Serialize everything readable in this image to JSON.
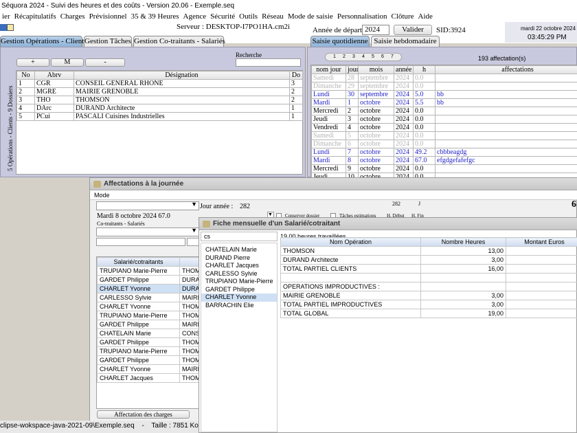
{
  "window": {
    "title": "Séquora 2024 - Suivi des heures et des coûts - Version 20.06 - Exemple.seq"
  },
  "menu": [
    "ier",
    "Récapitulatifs",
    "Charges",
    "Prévisionnel",
    "35 & 39 Heures",
    "Agence",
    "Sécurité",
    "Outils",
    "Réseau",
    "Mode de saisie",
    "Personnalisation",
    "Clôture",
    "Aide"
  ],
  "header": {
    "server_label": "Serveur : DESKTOP-I7PO1HA.cm2i",
    "year_label": "Année de départ :",
    "year_value": "2024",
    "validate_label": "Valider",
    "sid": "SID:3924",
    "date": "mardi 22 octobre 2024",
    "time": "03:45:29 PM"
  },
  "tabs_left": [
    "Gestion Opérations - Clients",
    "Gestion Tâches",
    "Gestion Co-traitants - Salariés"
  ],
  "tabs_right": [
    "Saisie quotidienne",
    "Saisie hebdomadaire"
  ],
  "operations": {
    "buttons": [
      "+",
      "M",
      "-"
    ],
    "search_label": "Recherche",
    "side_label": "5 Opérations - Clients - 9 Dossiers",
    "columns": [
      "No",
      "Abrv",
      "Désignation",
      "Do"
    ],
    "rows": [
      [
        "1",
        "CGR",
        "CONSEIL GENERAL RHONE",
        "3"
      ],
      [
        "2",
        "MGRE",
        "MAIRIE GRENOBLE",
        "2"
      ],
      [
        "3",
        "THO",
        "THOMSON",
        "2"
      ],
      [
        "4",
        "DArc",
        "DURAND Architecte",
        "1"
      ],
      [
        "5",
        "PCui",
        "PASCALI Cuisines Industrielles",
        "1"
      ]
    ]
  },
  "daily": {
    "pages": [
      "1",
      "2",
      "3",
      "4",
      "5",
      "6",
      "7"
    ],
    "count_label": "193 affectation(s)",
    "columns": [
      "nom jour",
      "jour",
      "mois",
      "année",
      "h",
      "affectations"
    ],
    "rows": [
      {
        "cells": [
          "Samedi",
          "28",
          "septembre",
          "2024",
          "0.0",
          ""
        ],
        "style": "grey"
      },
      {
        "cells": [
          "Dimanche",
          "29",
          "septembre",
          "2024",
          "0.0",
          ""
        ],
        "style": "grey"
      },
      {
        "cells": [
          "Lundi",
          "30",
          "septembre",
          "2024",
          "5.0",
          "bb"
        ],
        "style": "blue"
      },
      {
        "cells": [
          "Mardi",
          "1",
          "octobre",
          "2024",
          "5.5",
          "bb"
        ],
        "style": "blue"
      },
      {
        "cells": [
          "Mercredi",
          "2",
          "octobre",
          "2024",
          "0.0",
          ""
        ],
        "style": ""
      },
      {
        "cells": [
          "Jeudi",
          "3",
          "octobre",
          "2024",
          "0.0",
          ""
        ],
        "style": ""
      },
      {
        "cells": [
          "Vendredi",
          "4",
          "octobre",
          "2024",
          "0.0",
          ""
        ],
        "style": ""
      },
      {
        "cells": [
          "Samedi",
          "5",
          "octobre",
          "2024",
          "0.0",
          ""
        ],
        "style": "grey"
      },
      {
        "cells": [
          "Dimanche",
          "6",
          "octobre",
          "2024",
          "0.0",
          ""
        ],
        "style": "grey"
      },
      {
        "cells": [
          "Lundi",
          "7",
          "octobre",
          "2024",
          "49.2",
          "cbbbeagdg"
        ],
        "style": "blue"
      },
      {
        "cells": [
          "Mardi",
          "8",
          "octobre",
          "2024",
          "67.0",
          "efgdgefafefgc"
        ],
        "style": "blue"
      },
      {
        "cells": [
          "Mercredi",
          "9",
          "octobre",
          "2024",
          "0.0",
          ""
        ],
        "style": ""
      },
      {
        "cells": [
          "Jeudi",
          "10",
          "octobre",
          "2024",
          "0.0",
          ""
        ],
        "style": ""
      }
    ]
  },
  "affectations": {
    "title": "Affectations à la journée",
    "mode_label": "Mode",
    "jour_annee_label": "Jour année :",
    "jour_annee_value": "282",
    "top_num": "282",
    "top_j": "J",
    "big_num": "6",
    "date_line": "Mardi 8 octobre 2024 67.0",
    "cotraitants_label": "Co-traitants - Salariés",
    "conserver_label": "Conserver dossier",
    "taches_label": "Tâches estimations",
    "debut_label": "H. Début",
    "fin_label": "H. Fin",
    "columns": [
      "Salarié/cotraitants",
      ""
    ],
    "rows": [
      [
        "TRUPIANO Marie-Pierre",
        "THOMS"
      ],
      [
        "GARDET Philippe",
        "DURAN"
      ],
      [
        "CHARLET Yvonne",
        "DURAN"
      ],
      [
        "CARLESSO Sylvie",
        "MAIRIE"
      ],
      [
        "CHARLET Yvonne",
        "THOMS"
      ],
      [
        "TRUPIANO Marie-Pierre",
        "THOMS"
      ],
      [
        "GARDET Philippe",
        "MAIRIE"
      ],
      [
        "CHATELAIN Marie",
        "CONSE"
      ],
      [
        "GARDET Philippe",
        "THOMS"
      ],
      [
        "TRUPIANO Marie-Pierre",
        "THOMS"
      ],
      [
        "GARDET Philippe",
        "THOMS"
      ],
      [
        "CHARLET Yvonne",
        "MAIRIE"
      ],
      [
        "CHARLET Jacques",
        "THOMS"
      ]
    ],
    "selected_row": 2,
    "bottom_button": "Affectation des charges"
  },
  "fiche": {
    "title": "Fiche mensuelle d'un Salarié/cotraitant",
    "search_value": "cs",
    "hours_label": "19,00 heures travaillées",
    "employees": [
      "CHATELAIN Marie",
      "DURAND Pierre",
      "CHARLET Jacques",
      "CARLESSO Sylvie",
      "TRUPIANO Marie-Pierre",
      "GARDET Philippe",
      "CHARLET Yvonne",
      "BARRACHIN Elie"
    ],
    "selected_employee": 6,
    "columns": [
      "Nom Opération",
      "Nombre Heures",
      "Montant Euros"
    ],
    "rows": [
      [
        "THOMSON",
        "13,00",
        ""
      ],
      [
        "DURAND Architecte",
        "3,00",
        ""
      ],
      [
        "TOTAL PARTIEL CLIENTS",
        "16,00",
        ""
      ],
      [
        "",
        "",
        ""
      ],
      [
        "OPERATIONS IMPRODUCTIVES :",
        "",
        ""
      ],
      [
        "MAIRIE GRENOBLE",
        "3,00",
        ""
      ],
      [
        "TOTAL PARTIEL IMPRODUCTIVES",
        "3,00",
        ""
      ],
      [
        "TOTAL GLOBAL",
        "19,00",
        ""
      ]
    ]
  },
  "status": {
    "path": "clipse-wokspace-java-2021-09\\Exemple.seq",
    "sep": "-",
    "size": "Taille : 7851 Ko"
  },
  "colors": {
    "panel": "#c8c8de",
    "tab_active": "#8fb3d9",
    "weekday_blue": "#2323c8",
    "weekend_grey": "#b4b4b4"
  }
}
